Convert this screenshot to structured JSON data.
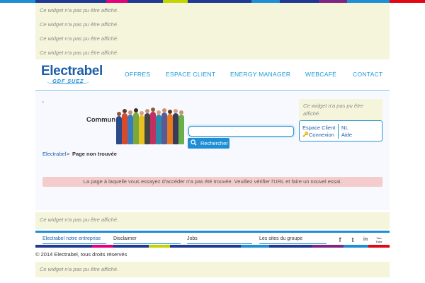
{
  "top_widgets": [
    "Ce widget n'a pas pu être affiché.",
    "Ce widget n'a pas pu être affiché.",
    "Ce widget n'a pas pu être affiché.",
    "Ce widget n'a pas pu être affiché."
  ],
  "brand_colors": [
    "#e4007d",
    "#1f3a93",
    "#7d2682",
    "#c2d500",
    "#f7a600",
    "#1f8ed4",
    "#e30613"
  ],
  "logo": {
    "name": "Electrabel",
    "tagline": "GDF SUEZ"
  },
  "nav": [
    "OFFRES",
    "ESPACE CLIENT",
    "ENERGY MANAGER",
    "WEBCAFÉ",
    "CONTACT"
  ],
  "search": {
    "title": "Commun",
    "placeholder": "",
    "button_label": "Rechercher"
  },
  "side_widget": "Ce widget n'a pas pu être affiché.",
  "client_box": {
    "espace_client": "Espace Client",
    "connexion": "Connexion",
    "nl": "NL",
    "aide": "Aide"
  },
  "breadcrumb": {
    "home": "Electrabel",
    "separator": ">",
    "current": "Page non trouvée"
  },
  "error_message": "La page à laquelle vous essayez d'accéder n'a pas été trouvée. Veuillez vérifier l'URL et faire un nouvel essai.",
  "bottom_widget": "Ce widget n'a pas pu être affiché.",
  "footer_links": [
    "Electrabel notre entreprise",
    "Disclaimer",
    "Jobs",
    "Les sites du groupe"
  ],
  "social": [
    "f",
    "t",
    "in",
    "You Tube"
  ],
  "copyright": "© 2014 Electrabel, tous droits réservés",
  "final_widget": "Ce widget n'a pas pu être affiché."
}
